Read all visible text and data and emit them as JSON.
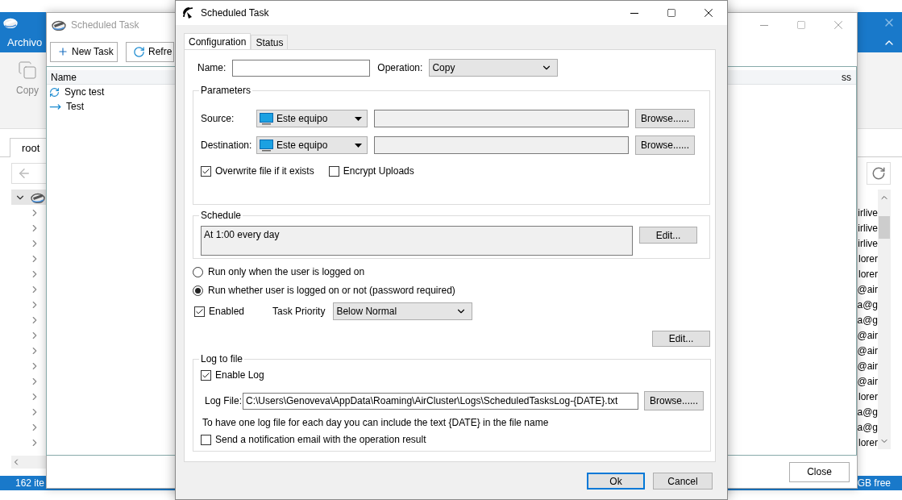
{
  "background_window": {
    "menu_tab": "Archivo",
    "ribbon_button": "Copy",
    "tabs": [
      {
        "label": "root",
        "selected": true
      }
    ],
    "tree": {
      "expanded": true,
      "children": [
        {
          "expanded": false,
          "column_2": "irlive"
        },
        {
          "expanded": false,
          "column_2": "irlive"
        },
        {
          "expanded": false,
          "column_2": "irlive"
        },
        {
          "expanded": false,
          "column_2": "lorer"
        },
        {
          "expanded": false,
          "column_2": "lorer"
        },
        {
          "expanded": false,
          "column_2": "@air"
        },
        {
          "expanded": false,
          "column_2": "a@g"
        },
        {
          "expanded": false,
          "column_2": "a@g"
        },
        {
          "expanded": false,
          "column_2": "@air"
        },
        {
          "expanded": false,
          "column_2": "@air"
        },
        {
          "expanded": false,
          "column_2": "@air"
        },
        {
          "expanded": false,
          "column_2": "@air"
        },
        {
          "expanded": false,
          "column_2": "lorer"
        },
        {
          "expanded": false,
          "column_2": "a@g"
        },
        {
          "expanded": false,
          "column_2": "a@g"
        },
        {
          "expanded": false,
          "column_2": "lorer"
        }
      ]
    },
    "status_left": "162 ite",
    "status_right": "GB free"
  },
  "task_window": {
    "title": "Scheduled Task",
    "toolbar": [
      {
        "label": "New Task",
        "kind": "add"
      },
      {
        "label": "Refre",
        "kind": "refresh"
      }
    ],
    "columns": [
      "Name",
      "ss"
    ],
    "rows": [
      {
        "name": "Sync test",
        "kind": "sync"
      },
      {
        "name": "Test",
        "kind": "copy"
      }
    ],
    "close_button": "Close"
  },
  "dialog": {
    "title": "Scheduled Task",
    "tabs": [
      {
        "label": "Configuration",
        "selected": true
      },
      {
        "label": "Status",
        "selected": false
      }
    ],
    "name_label": "Name:",
    "operation_label": "Operation:",
    "operation": "Copy",
    "parameters": {
      "legend": "Parameters",
      "locations": [
        {
          "label": "Source:",
          "device": "Este equipo",
          "browse": "Browse......"
        },
        {
          "label": "Destination:",
          "device": "Este equipo",
          "browse": "Browse......"
        }
      ],
      "options": [
        {
          "label": "Overwrite file if it exists",
          "checked": true
        },
        {
          "label": "Encrypt Uploads",
          "checked": false
        }
      ]
    },
    "schedule": {
      "legend": "Schedule",
      "text": "At 1:00 every day",
      "edit": "Edit..."
    },
    "run_modes": [
      {
        "label": "Run only when the user is logged on",
        "selected": false
      },
      {
        "label": "Run whether user is logged on or not (password required)",
        "selected": true
      }
    ],
    "enabled": {
      "label": "Enabled",
      "checked": true
    },
    "priority_label": "Task Priority",
    "priority": "Below Normal",
    "edit": "Edit...",
    "log": {
      "legend": "Log to file",
      "enable": {
        "label": "Enable Log",
        "checked": true
      },
      "file_label": "Log File:",
      "file": "C:\\Users\\Genoveva\\AppData\\Roaming\\AirCluster\\Logs\\ScheduledTasksLog-{DATE}.txt",
      "browse": "Browse......",
      "hint": "To have one log file for each day you can include the text {DATE} in the file name",
      "notify": {
        "label": "Send a notification email with the operation result",
        "checked": false
      }
    },
    "buttons": [
      {
        "label": "Ok",
        "default": true
      },
      {
        "label": "Cancel",
        "default": false
      }
    ]
  }
}
